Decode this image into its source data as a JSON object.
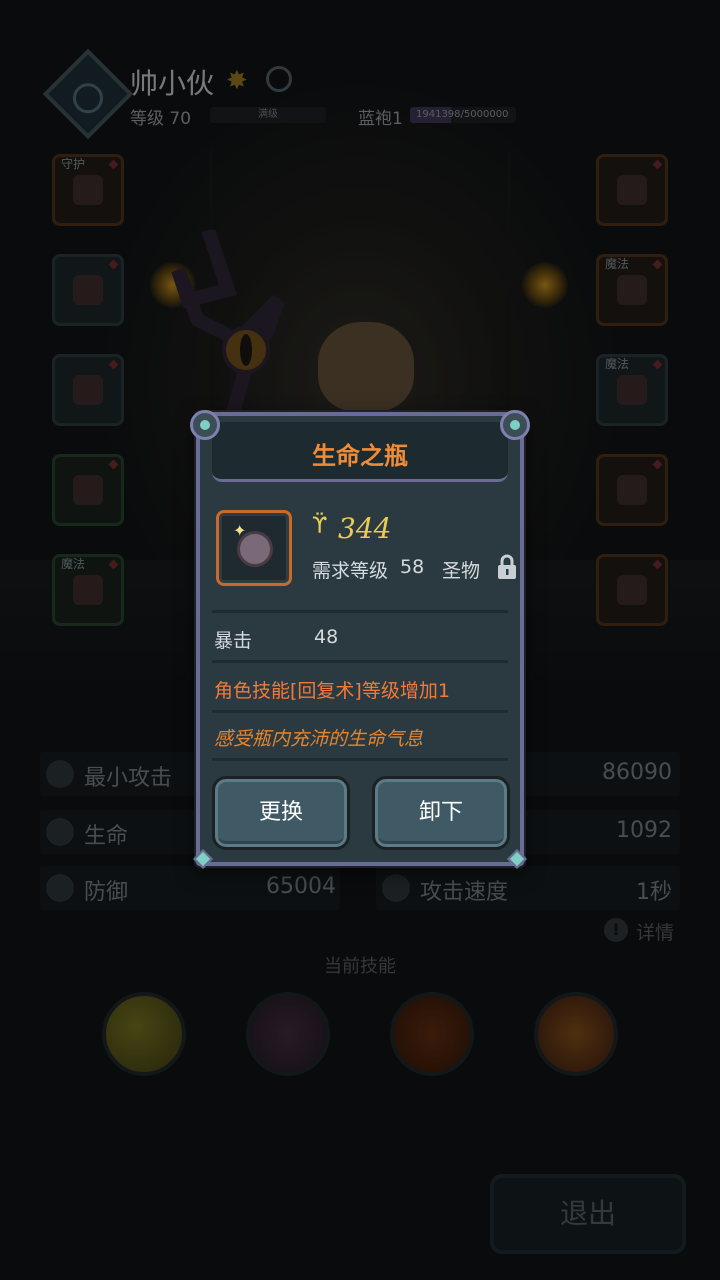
{
  "header": {
    "player_name": "帅小伙",
    "level_label": "等级 70",
    "level_bar_text": "满级",
    "rank_label": "蓝袍1",
    "xp_text": "1941398/5000000",
    "xp_progress": 0.388
  },
  "equipment_slots": {
    "left": [
      {
        "tag": "守护"
      },
      {
        "tag": ""
      },
      {
        "tag": ""
      },
      {
        "tag": ""
      },
      {
        "tag": "魔法"
      }
    ],
    "right": [
      {
        "tag": ""
      },
      {
        "tag": "魔法"
      },
      {
        "tag": "魔法"
      },
      {
        "tag": ""
      },
      {
        "tag": ""
      }
    ]
  },
  "stats": {
    "min_attack_label": "最小攻击",
    "min_attack_value": "86090",
    "hp_label": "生命",
    "hp_value": "1092",
    "defense_label": "防御",
    "defense_value": "65004",
    "attack_speed_label": "攻击速度",
    "attack_speed_value": "1秒",
    "details_label": "详情"
  },
  "skills": {
    "title": "当前技能",
    "icons": [
      "bubble-skill-icon",
      "dagger-skill-icon",
      "flame-shield-skill-icon",
      "explosion-skill-icon"
    ]
  },
  "exit_label": "退出",
  "modal": {
    "title": "生命之瓶",
    "power": "344",
    "requirement_label": "需求等级",
    "requirement_value": "58",
    "rarity": "圣物",
    "stat_name": "暴击",
    "stat_value": "48",
    "skill_effect": "角色技能[回复术]等级增加1",
    "flavor_text": "感受瓶内充沛的生命气息",
    "replace_label": "更换",
    "unequip_label": "卸下"
  },
  "colors": {
    "title_orange": "#f08c38",
    "power_gold": "#e8cc56",
    "effect_orange": "#f07a3a",
    "modal_bg": "#2b3a40",
    "modal_border": "#6a6c95",
    "button_bg": "#3f5a64"
  }
}
